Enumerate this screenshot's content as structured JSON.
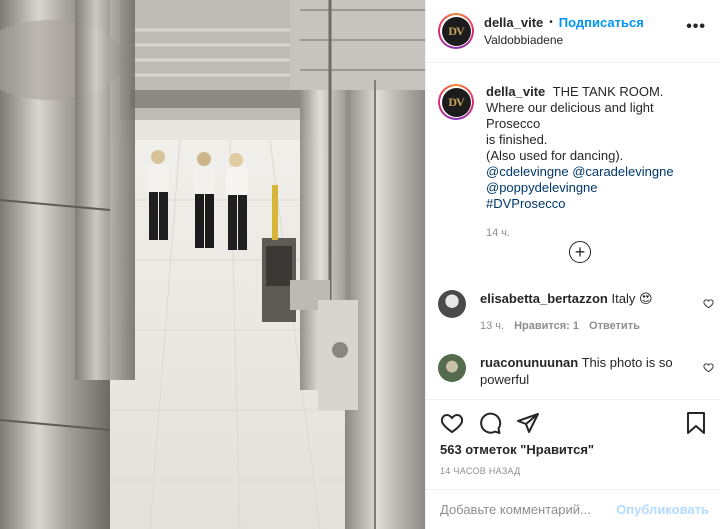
{
  "post": {
    "username": "della_vite",
    "follow_label": "Подписаться",
    "separator": "•",
    "location": "Valdobbiadene",
    "avatar_letters": "DV",
    "more_label": "•••"
  },
  "caption": {
    "username": "della_vite",
    "lines": [
      "THE TANK ROOM.",
      "Where our delicious and light Prosecco",
      "is finished.",
      "(Also used for dancing)."
    ],
    "links": [
      "@cdelevingne @caradelevingne",
      "@poppydelevingne",
      "#DVProsecco"
    ],
    "time_ago": "14 ч."
  },
  "load_more_label": "+",
  "comments": [
    {
      "username": "elisabetta_bertazzon",
      "text": "Italy 😍",
      "time": "13 ч.",
      "likes": "Нравится: 1",
      "reply": "Ответить"
    },
    {
      "username": "ruaconunuunan",
      "text": "This photo is so powerful"
    }
  ],
  "likes_label": "563 отметок \"Нравится\"",
  "date_label": "14 ЧАСОВ НАЗАД",
  "add_comment": {
    "placeholder": "Добавьте комментарий...",
    "publish_label": "Опубликовать"
  },
  "icons": [
    "heart-icon",
    "comment-icon",
    "share-icon",
    "bookmark-icon",
    "more-icon",
    "plus-circle-icon"
  ]
}
